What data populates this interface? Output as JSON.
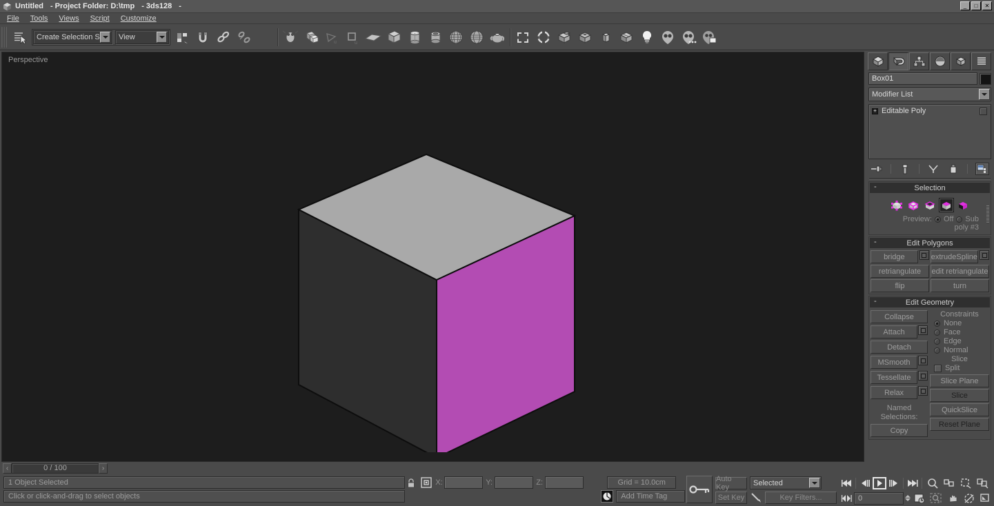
{
  "window": {
    "app_icon": "box-logo-icon",
    "title": "Untitled",
    "project_label": "- Project Folder: D:\\tmp",
    "build_label": "- 3ds128",
    "trailing_dash": "-",
    "minimize": "_",
    "maximize": "□",
    "close": "✕"
  },
  "menu": {
    "items": [
      "File",
      "Tools",
      "Views",
      "Script",
      "Customize"
    ]
  },
  "toolbar": {
    "selection_set": {
      "value": "Create Selection Set",
      "placeholder": "Create Selection Set"
    },
    "reference_coord": {
      "value": "View"
    },
    "icons": [
      "select-by-name-icon",
      "selection-region-icon",
      "snaps-toggle-icon",
      "link-icon",
      "unlink-icon",
      "bind-space-warp-icon",
      "select-object-icon",
      "select-move-icon",
      "select-rotate-icon",
      "select-scale-icon",
      "mirror-icon",
      "box-primitive-icon",
      "cylinder-primitive-icon",
      "tube-primitive-icon",
      "sphere-primitive-icon",
      "geosphere-primitive-icon",
      "teapot-primitive-icon",
      "rectangle-shape-icon",
      "ngon-shape-icon",
      "boolean-icon",
      "proboolean-icon",
      "chamferbox-icon",
      "chamfercyl-icon",
      "omni-light-icon",
      "target-camera-icon",
      "free-camera-icon",
      "render-setup-icon"
    ]
  },
  "viewport": {
    "label": "Perspective",
    "background": "#1d1d1d",
    "object": {
      "name": "Box01",
      "top_face_color": "#a9a9a9",
      "right_face_color": "#b34cb3",
      "left_face_color": "#2e2e2e",
      "edge_color": "#0d0d0d"
    }
  },
  "timeline": {
    "prev_label": "‹",
    "next_label": "›",
    "frame_text": "0 / 100"
  },
  "command_panel": {
    "tabs": [
      {
        "name": "create-tab",
        "icon": "create-box-icon",
        "active": false
      },
      {
        "name": "modify-tab",
        "icon": "modify-bend-icon",
        "active": true
      },
      {
        "name": "hierarchy-tab",
        "icon": "hierarchy-icon",
        "active": false
      },
      {
        "name": "motion-tab",
        "icon": "motion-wheel-icon",
        "active": false
      },
      {
        "name": "display-tab",
        "icon": "display-cube-icon",
        "active": false
      },
      {
        "name": "utilities-tab",
        "icon": "utilities-hammer-icon",
        "active": false
      }
    ],
    "object_name": {
      "value": "Box01"
    },
    "object_color": "#131313",
    "modifier_list": {
      "value": "Modifier List"
    },
    "modifier_stack": [
      {
        "label": "Editable Poly",
        "expandable": "+",
        "checkbox": false
      }
    ],
    "stack_buttons": [
      "pin-stack-icon",
      "show-end-result-icon",
      "make-unique-icon",
      "remove-modifier-icon",
      "configure-modifier-sets-icon"
    ],
    "rollouts": {
      "selection": {
        "title": "Selection",
        "collapse": "-",
        "subobject_levels": [
          {
            "name": "vertex-level-button",
            "label": "Vertex",
            "active": false
          },
          {
            "name": "edge-level-button",
            "label": "Edge",
            "active": false
          },
          {
            "name": "border-level-button",
            "label": "Border",
            "active": false
          },
          {
            "name": "polygon-level-button",
            "label": "Polygon",
            "active": true
          },
          {
            "name": "element-level-button",
            "label": "Element",
            "active": false
          }
        ],
        "preview_label": "Preview:",
        "preview_off": "Off",
        "preview_sub": "Sub",
        "preview_selected": "off",
        "status_text": "poly #3"
      },
      "edit_polygons": {
        "title": "Edit Polygons",
        "collapse": "-",
        "rows": [
          [
            {
              "label": "bridge",
              "settings": true
            },
            {
              "label": "extrudeSpline",
              "settings": true
            }
          ],
          [
            {
              "label": "retriangulate",
              "settings": false
            },
            {
              "label": "edit retriangulate",
              "settings": false
            }
          ],
          [
            {
              "label": "flip",
              "settings": false
            },
            {
              "label": "turn",
              "settings": false
            }
          ]
        ]
      },
      "edit_geometry": {
        "title": "Edit Geometry",
        "collapse": "-",
        "left_buttons": [
          {
            "label": "Collapse",
            "settings": false
          },
          {
            "label": "Attach",
            "settings": true
          },
          {
            "label": "Detach",
            "settings": false
          },
          {
            "label": "MSmooth",
            "settings": true
          },
          {
            "label": "Tessellate",
            "settings": true
          },
          {
            "label": "Relax",
            "settings": true
          }
        ],
        "constraints_label": "Constraints",
        "constraints": [
          {
            "label": "None",
            "selected": true
          },
          {
            "label": "Face",
            "selected": false
          },
          {
            "label": "Edge",
            "selected": false
          },
          {
            "label": "Normal",
            "selected": false
          }
        ],
        "slice_label": "Slice",
        "split_label": "Split",
        "split_checked": false,
        "right_buttons": [
          {
            "label": "Slice Plane",
            "dark": false
          },
          {
            "label": "Slice",
            "dark": true
          },
          {
            "label": "QuickSlice",
            "dark": false
          },
          {
            "label": "Reset Plane",
            "dark": true
          }
        ],
        "named_selections_label": "Named Selections:",
        "copy_label": "Copy"
      }
    }
  },
  "statusbar": {
    "selection_text": "1 Object Selected",
    "prompt_text": "Click or click-and-drag to select objects",
    "lock_icon": "selection-lock-icon",
    "absolute_mode_icon": "absolute-relative-icon",
    "x_label": "X:",
    "y_label": "Y:",
    "z_label": "Z:",
    "x_value": "",
    "y_value": "",
    "z_value": "",
    "grid_text": "Grid = 10.0cm",
    "time_tag_text": "Add Time Tag",
    "time_tag_icon": "time-tag-icon",
    "key_mode_icon": "key-mode-icon",
    "auto_key": "Auto Key",
    "set_key": "Set Key",
    "set_key_filter": "Selected",
    "key_filters": "Key Filters...",
    "key_tangent_icon": "key-tangent-icon",
    "playback": {
      "go_to_start": "go-to-start-icon",
      "prev_frame": "previous-frame-icon",
      "play": "play-animation-icon",
      "next_frame": "next-frame-icon",
      "go_to_end": "go-to-end-icon",
      "key_mode": "key-mode-toggle-icon",
      "current_frame": "0"
    },
    "nav_icons_top": [
      "zoom-icon",
      "zoom-all-icon",
      "zoom-extents-icon",
      "zoom-extents-all-icon"
    ],
    "nav_icons_bottom": [
      "zoom-region-icon",
      "pan-view-icon",
      "arc-rotate-icon",
      "maximize-viewport-icon"
    ]
  }
}
